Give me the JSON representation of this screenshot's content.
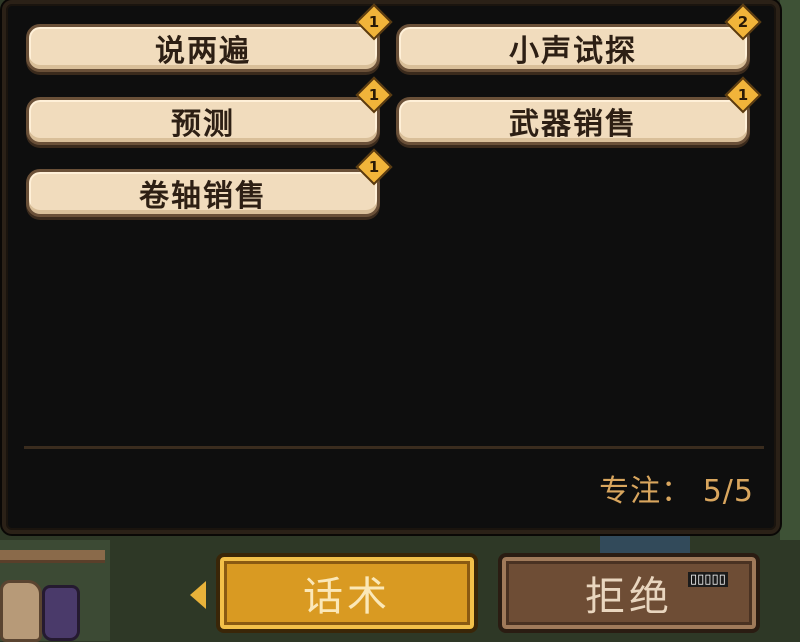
{
  "options": [
    {
      "label": "说两遍",
      "badge": "1"
    },
    {
      "label": "小声试探",
      "badge": "2"
    },
    {
      "label": "预测",
      "badge": "1"
    },
    {
      "label": "武器销售",
      "badge": "1"
    },
    {
      "label": "卷轴销售",
      "badge": "1"
    }
  ],
  "focus_text": "专注： 5/5",
  "buttons": {
    "talk_label": "话术",
    "refuse_label": "拒绝",
    "refuse_hint": "▯▯▯▯▯"
  },
  "colors": {
    "panel_bg": "#0e0e0e",
    "option_bg": "#f1dcbd",
    "badge": "#f1b43a",
    "focus_text": "#d9a65e",
    "talk_button": "#d99a22",
    "refuse_button": "#6e4d35"
  }
}
